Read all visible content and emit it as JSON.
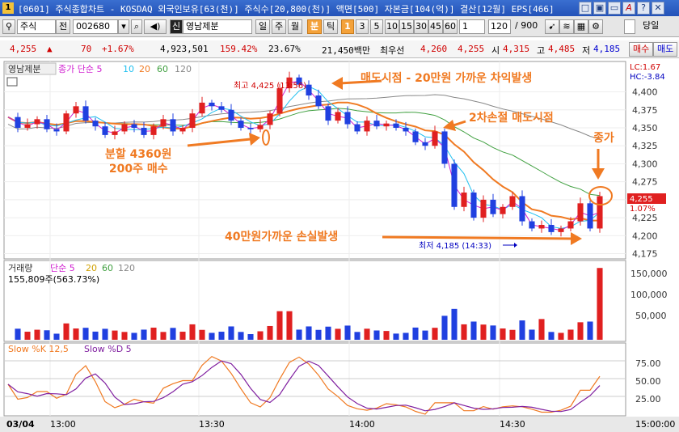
{
  "window": {
    "title": "[0601] 주식종합차트 - KOSDAQ 외국인보유[63(천)] 주식수[20,800(천)] 액면[500] 자본금[104(억)] 결산[12월] EPS[466]",
    "icon_label": "1",
    "buttons": [
      "□",
      "▣",
      "▭",
      "A",
      "?",
      "✕"
    ]
  },
  "toolbar": {
    "market": "주식",
    "prev_label": "전",
    "code": "002680",
    "stock_name": "영남제분",
    "stock_prefix": "신",
    "periods": [
      "일",
      "주",
      "월"
    ],
    "minute_label": "분",
    "tick_label": "틱",
    "intervals": [
      "1",
      "3",
      "5",
      "10",
      "15",
      "30",
      "45",
      "60"
    ],
    "interval_value": "1",
    "count_value": "120",
    "total_count": "/ 900",
    "today_label": "당일"
  },
  "quote": {
    "price": "4,255",
    "change_arrow": "▲",
    "change": "70",
    "change_pct": "+1.67%",
    "volume": "4,923,501",
    "volume_ratio": "159.42%",
    "turnover": "23.67%",
    "amount": "21,450백만",
    "best_label": "최우선",
    "ask": "4,260",
    "bid": "4,255",
    "open_label": "시",
    "open": "4,315",
    "high_label": "고",
    "high": "4,485",
    "low_label": "저",
    "low": "4,185",
    "buy_button": "매수",
    "sell_button": "매도"
  },
  "price_panel": {
    "stock_tag": "영남제분",
    "ma_legend": [
      "종가 단순 5",
      "10",
      "20",
      "60",
      "120"
    ],
    "high_label": "최고 4,425 (13:56)",
    "low_label": "최저 4,185 (14:33)",
    "lc": "LC:1.67",
    "hc": "HC:-3.84",
    "current_price": "4,255",
    "current_pct": "1.07%",
    "y_ticks": [
      "4,400",
      "4,375",
      "4,350",
      "4,325",
      "4,300",
      "4,275",
      "4,250",
      "4,225",
      "4,200",
      "4,175"
    ]
  },
  "volume_panel": {
    "legend": [
      "거래량",
      "단순 5",
      "20",
      "60",
      "120"
    ],
    "current": "155,809주(563.73%)",
    "y_ticks": [
      "150,000",
      "100,000",
      "50,000"
    ]
  },
  "stoch_panel": {
    "legend": [
      "Slow %K 12,5",
      "Slow %D 5"
    ],
    "y_ticks": [
      "75.00",
      "50.00",
      "25.00"
    ]
  },
  "time_axis": [
    "03/04",
    "13:00",
    "13:30",
    "14:00",
    "14:30",
    "15:00:00"
  ],
  "annotations": {
    "sell_point": "매도시점 - 20만원 가까운 차익발생",
    "second_stop": "2차손절 매도시점",
    "close_label": "종가",
    "split_buy": "분할 4360원\n200주 매수",
    "loss": "40만원가까운 손실발생"
  },
  "colors": {
    "up": "#e02020",
    "down": "#2040e0",
    "ma5": "#d020d0",
    "ma10": "#20c0f0",
    "ma20": "#f07a22",
    "ma60": "#40a040",
    "ma120": "#888888",
    "annotation": "#f07a22"
  },
  "chart_data": [
    {
      "type": "candlestick",
      "series": [
        {
          "name": "종가",
          "close_path": [
            4365,
            4350,
            4355,
            4362,
            4348,
            4345,
            4370,
            4380,
            4360,
            4352,
            4340,
            4345,
            4355,
            4350,
            4340,
            4352,
            4362,
            4345,
            4350,
            4370,
            4385,
            4380,
            4375,
            4360,
            4350,
            4348,
            4354,
            4370,
            4405,
            4420,
            4410,
            4395,
            4380,
            4360,
            4372,
            4355,
            4345,
            4360,
            4352,
            4356,
            4350,
            4345,
            4330,
            4325,
            4345,
            4300,
            4240,
            4260,
            4225,
            4250,
            4230,
            4240,
            4255,
            4220,
            4210,
            4215,
            4205,
            4210,
            4220,
            4245,
            4210,
            4255
          ]
        }
      ],
      "ylim": [
        4170,
        4440
      ],
      "high": 4425,
      "low": 4185
    },
    {
      "type": "bar",
      "name": "거래량",
      "ylim": [
        0,
        165000
      ]
    },
    {
      "type": "line",
      "series": [
        {
          "name": "Slow %K 12,5"
        },
        {
          "name": "Slow %D 5"
        }
      ],
      "ylim": [
        0,
        100
      ]
    }
  ]
}
